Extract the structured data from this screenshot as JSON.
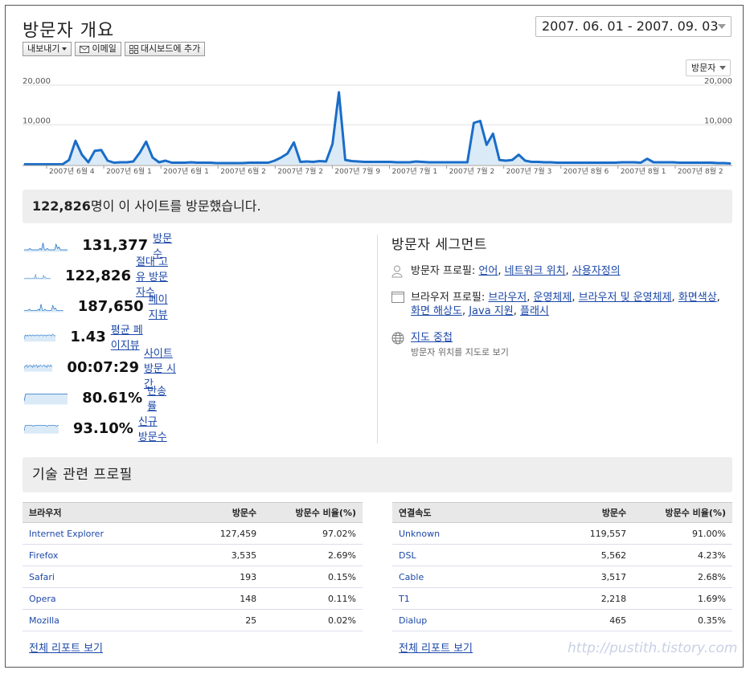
{
  "header": {
    "title": "방문자 개요",
    "date_range": "2007. 06. 01 - 2007. 09. 03",
    "toolbar": {
      "export": "내보내기",
      "email": "이메일",
      "dashboard": "대시보드에 추가"
    },
    "metric_selector": "방문자"
  },
  "chart_data": {
    "type": "area",
    "y_ticks": [
      "20,000",
      "10,000"
    ],
    "ylim": [
      0,
      20000
    ],
    "x_tick_labels": [
      "2007년 6월 4",
      "2007년 6월 1",
      "2007년 6월 1",
      "2007년 6월 2",
      "2007년 7월 2",
      "2007년 7월 9",
      "2007년 7월 1",
      "2007년 7월 2",
      "2007년 7월 3",
      "2007년 8월 6",
      "2007년 8월 1",
      "2007년 8월 2"
    ],
    "series": [
      {
        "values": [
          100,
          100,
          100,
          100,
          100,
          100,
          100,
          1200,
          6000,
          2500,
          600,
          3500,
          3700,
          1000,
          500,
          600,
          600,
          800,
          3000,
          5800,
          1800,
          600,
          1000,
          500,
          500,
          500,
          600,
          500,
          500,
          500,
          400,
          400,
          400,
          400,
          400,
          500,
          500,
          500,
          500,
          1000,
          1800,
          2800,
          5600,
          700,
          800,
          700,
          900,
          800,
          5200,
          18200,
          1200,
          900,
          800,
          700,
          700,
          700,
          700,
          700,
          600,
          600,
          600,
          800,
          700,
          600,
          600,
          600,
          600,
          600,
          600,
          600,
          10500,
          11000,
          5000,
          7800,
          1200,
          1000,
          1200,
          2500,
          1000,
          700,
          700,
          600,
          600,
          500,
          500,
          500,
          500,
          500,
          500,
          500,
          500,
          500,
          500,
          600,
          600,
          600,
          500,
          1500,
          600,
          600,
          600,
          600,
          500,
          500,
          500,
          500,
          500,
          500,
          400,
          400,
          300
        ]
      }
    ]
  },
  "summary": {
    "count": "122,826",
    "text": "명이 이 사이트를 방문했습니다."
  },
  "metrics": [
    {
      "value": "131,377",
      "label": "방문수"
    },
    {
      "value": "122,826",
      "label": "절대 고유 방문자수"
    },
    {
      "value": "187,650",
      "label": "페이지뷰"
    },
    {
      "value": "1.43",
      "label": "평균 페이지뷰"
    },
    {
      "value": "00:07:29",
      "label": "사이트 방문 시간"
    },
    {
      "value": "80.61%",
      "label": "반송률"
    },
    {
      "value": "93.10%",
      "label": "신규 방문수"
    }
  ],
  "segments": {
    "title": "방문자 세그먼트",
    "visitor_profile": {
      "label": "방문자 프로필:",
      "links": [
        "언어",
        "네트워크 위치",
        "사용자정의"
      ]
    },
    "browser_profile": {
      "label": "브라우저 프로필:",
      "links": [
        "브라우저",
        "운영체제",
        "브라우저 및 운영체제",
        "화면색상",
        "화면 해상도",
        "Java 지원",
        "플래시"
      ]
    },
    "map_overlay": {
      "label": "지도 중첩",
      "sub": "방문자 위치를 지도로 보기"
    }
  },
  "tech": {
    "title": "기술 관련 프로필",
    "browsers": {
      "headers": [
        "브라우저",
        "방문수",
        "방문수 비율(%)"
      ],
      "rows": [
        [
          "Internet Explorer",
          "127,459",
          "97.02%"
        ],
        [
          "Firefox",
          "3,535",
          "2.69%"
        ],
        [
          "Safari",
          "193",
          "0.15%"
        ],
        [
          "Opera",
          "148",
          "0.11%"
        ],
        [
          "Mozilla",
          "25",
          "0.02%"
        ]
      ],
      "full_report": "전체 리포트 보기"
    },
    "connection": {
      "headers": [
        "연결속도",
        "방문수",
        "방문수 비율(%)"
      ],
      "rows": [
        [
          "Unknown",
          "119,557",
          "91.00%"
        ],
        [
          "DSL",
          "5,562",
          "4.23%"
        ],
        [
          "Cable",
          "3,517",
          "2.68%"
        ],
        [
          "T1",
          "2,218",
          "1.69%"
        ],
        [
          "Dialup",
          "465",
          "0.35%"
        ]
      ],
      "full_report": "전체 리포트 보기"
    }
  },
  "watermark": "http://pustith.tistory.com",
  "colors": {
    "line": "#1a6dc8",
    "fill": "#dbeaf7",
    "link": "#1c48a8"
  }
}
